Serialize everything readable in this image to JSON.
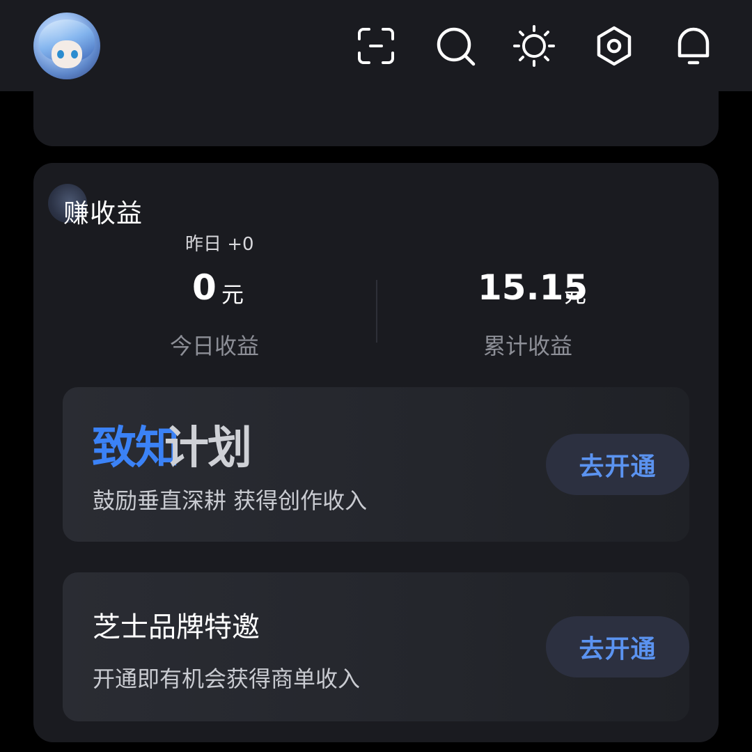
{
  "header": {
    "icons": [
      "scan-icon",
      "search-icon",
      "brightness-icon",
      "settings-icon",
      "bell-icon"
    ]
  },
  "earnings": {
    "title": "赚收益",
    "yesterday": "昨日 +0",
    "today": {
      "value": "0",
      "unit": "元",
      "label": "今日收益"
    },
    "total": {
      "value": "15.15",
      "unit": "元",
      "label": "累计收益"
    }
  },
  "plans": [
    {
      "title_highlight": "致知",
      "title_rest": "计划",
      "description": "鼓励垂直深耕 获得创作收入",
      "button": "去开通"
    },
    {
      "title": "芝士品牌特邀",
      "description": "开通即有机会获得商单收入",
      "button": "去开通"
    }
  ],
  "colors": {
    "background": "#000000",
    "card": "#1a1b20",
    "accent": "#3b82f6",
    "button_bg": "#2c3040",
    "button_text": "#5b93f0"
  }
}
